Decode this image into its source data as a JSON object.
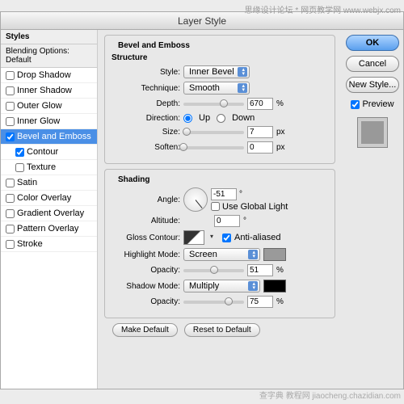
{
  "watermark_top": "思缘设计论坛 * 网页教学网 www.webjx.com",
  "watermark_bottom": "查字典 教程网 jiaocheng.chazidian.com",
  "dialog": {
    "title": "Layer Style"
  },
  "sidebar": {
    "header": "Styles",
    "blending": "Blending Options: Default",
    "items": [
      {
        "label": "Drop Shadow",
        "checked": false
      },
      {
        "label": "Inner Shadow",
        "checked": false
      },
      {
        "label": "Outer Glow",
        "checked": false
      },
      {
        "label": "Inner Glow",
        "checked": false
      },
      {
        "label": "Bevel and Emboss",
        "checked": true,
        "selected": true
      },
      {
        "label": "Contour",
        "checked": true,
        "sub": true
      },
      {
        "label": "Texture",
        "checked": false,
        "sub": true
      },
      {
        "label": "Satin",
        "checked": false
      },
      {
        "label": "Color Overlay",
        "checked": false
      },
      {
        "label": "Gradient Overlay",
        "checked": false
      },
      {
        "label": "Pattern Overlay",
        "checked": false
      },
      {
        "label": "Stroke",
        "checked": false
      }
    ]
  },
  "bevel": {
    "title": "Bevel and Emboss",
    "structure": {
      "title": "Structure",
      "style_label": "Style:",
      "style_value": "Inner Bevel",
      "technique_label": "Technique:",
      "technique_value": "Smooth",
      "depth_label": "Depth:",
      "depth_value": "670",
      "depth_unit": "%",
      "direction_label": "Direction:",
      "up_label": "Up",
      "down_label": "Down",
      "direction_value": "up",
      "size_label": "Size:",
      "size_value": "7",
      "size_unit": "px",
      "soften_label": "Soften:",
      "soften_value": "0",
      "soften_unit": "px"
    },
    "shading": {
      "title": "Shading",
      "angle_label": "Angle:",
      "angle_value": "-51",
      "angle_unit": "°",
      "global_light_label": "Use Global Light",
      "global_light_checked": false,
      "altitude_label": "Altitude:",
      "altitude_value": "0",
      "altitude_unit": "°",
      "gloss_label": "Gloss Contour:",
      "antialiased_label": "Anti-aliased",
      "antialiased_checked": true,
      "highlight_mode_label": "Highlight Mode:",
      "highlight_mode_value": "Screen",
      "highlight_color": "#9a9a9a",
      "highlight_opacity_label": "Opacity:",
      "highlight_opacity_value": "51",
      "highlight_opacity_unit": "%",
      "shadow_mode_label": "Shadow Mode:",
      "shadow_mode_value": "Multiply",
      "shadow_color": "#000000",
      "shadow_opacity_label": "Opacity:",
      "shadow_opacity_value": "75",
      "shadow_opacity_unit": "%"
    },
    "make_default": "Make Default",
    "reset_default": "Reset to Default"
  },
  "buttons": {
    "ok": "OK",
    "cancel": "Cancel",
    "new_style": "New Style...",
    "preview": "Preview"
  }
}
